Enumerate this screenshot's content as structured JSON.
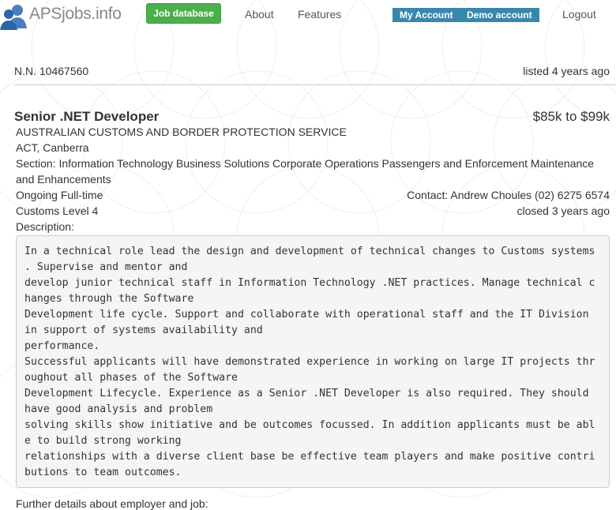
{
  "header": {
    "logo_text": "APSjobs.info",
    "job_database_label": "Job database",
    "about_label": "About",
    "features_label": "Features",
    "my_account_label": "My Account",
    "demo_account_label": "Demo account",
    "logout_label": "Logout"
  },
  "listing": {
    "notice_number": "N.N. 10467560",
    "listed": "listed 4 years ago",
    "title": "Senior .NET Developer",
    "salary": "$85k to $99k",
    "agency": "AUSTRALIAN CUSTOMS AND BORDER PROTECTION SERVICE",
    "location": "ACT, Canberra",
    "section_line1": "Section: Information Technology Business Solutions Corporate Operations Passengers and Enforcement Maintenance",
    "section_line2": "and Enhancements",
    "employment": "Ongoing Full-time",
    "contact": "Contact: Andrew Choules (02) 6275 6574",
    "level": "Customs Level 4",
    "closed": "closed 3 years ago",
    "description_label": "Description:",
    "description_lines": [
      "In a technical role lead the design and development of technical changes to Customs systems",
      ". Supervise and mentor and",
      "develop junior technical staff in Information Technology .NET practices. Manage technical c",
      "hanges through the Software",
      "Development life cycle. Support and collaborate with operational staff and the IT Division",
      "in support of systems availability and",
      "performance.",
      "Successful applicants will have demonstrated experience in working on large IT projects thr",
      "oughout all phases of the Software",
      "Development Lifecycle. Experience as a Senior .NET Developer is also required. They should",
      "have good analysis and problem",
      "solving skills show initiative and be outcomes focussed. In addition applicants must be abl",
      "e to build strong working",
      "relationships with a diverse client base be effective team players and make positive contri",
      "butions to team outcomes."
    ],
    "further_details": "Further details about employer and job:"
  }
}
